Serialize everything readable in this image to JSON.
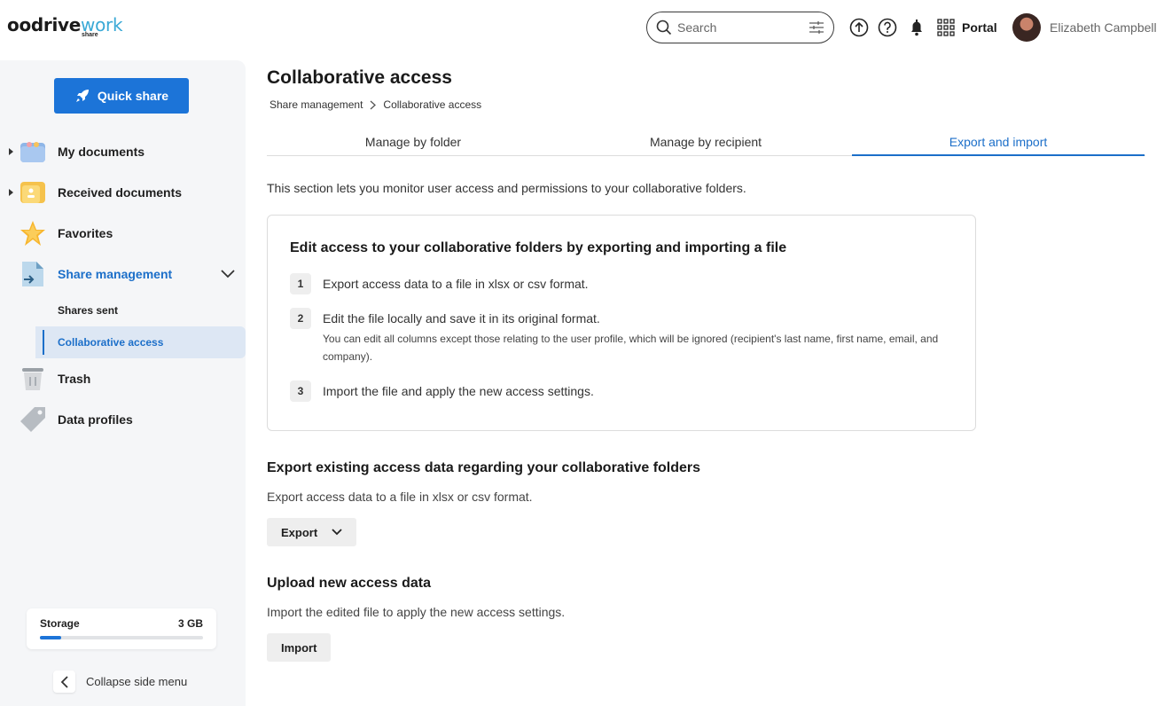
{
  "header": {
    "logo_main": "oodrive",
    "logo_work": "work",
    "logo_sub": "share",
    "search_placeholder": "Search",
    "portal_label": "Portal",
    "user_name": "Elizabeth Campbell"
  },
  "sidebar": {
    "quick_share_label": "Quick share",
    "items": [
      {
        "label": "My documents",
        "icon": "folder-icon"
      },
      {
        "label": "Received documents",
        "icon": "received-folder-icon"
      },
      {
        "label": "Favorites",
        "icon": "star-icon"
      },
      {
        "label": "Share management",
        "icon": "share-document-icon"
      },
      {
        "label": "Trash",
        "icon": "trash-icon"
      },
      {
        "label": "Data profiles",
        "icon": "tag-icon"
      }
    ],
    "sub_items": [
      {
        "label": "Shares sent"
      },
      {
        "label": "Collaborative access"
      }
    ],
    "storage": {
      "label": "Storage",
      "value": "3 GB",
      "fill_fraction": 0.13
    },
    "collapse_label": "Collapse side menu"
  },
  "main": {
    "title": "Collaborative access",
    "breadcrumb": [
      "Share management",
      "Collaborative access"
    ],
    "tabs": [
      {
        "label": "Manage by folder"
      },
      {
        "label": "Manage by recipient"
      },
      {
        "label": "Export and import"
      }
    ],
    "intro": "This section lets you monitor user access and permissions to your collaborative folders.",
    "card": {
      "title": "Edit access to your collaborative folders by exporting and importing a file",
      "steps": [
        {
          "num": "1",
          "text": "Export access data to a file in xlsx or csv format."
        },
        {
          "num": "2",
          "text": "Edit the file locally and save it in its original format.",
          "note": "You can edit all columns except those relating to the user profile, which will be ignored (recipient's last name, first name, email, and company)."
        },
        {
          "num": "3",
          "text": "Import the file and apply the new access settings."
        }
      ]
    },
    "export": {
      "title": "Export existing access data regarding your collaborative folders",
      "text": "Export access data to a file in xlsx or csv format.",
      "button": "Export"
    },
    "import": {
      "title": "Upload new access data",
      "text": "Import the edited file to apply the new access settings.",
      "button": "Import"
    }
  },
  "colors": {
    "accent": "#1c74d8",
    "link": "#1c6fc9",
    "sidebar_bg": "#f5f6f8"
  }
}
